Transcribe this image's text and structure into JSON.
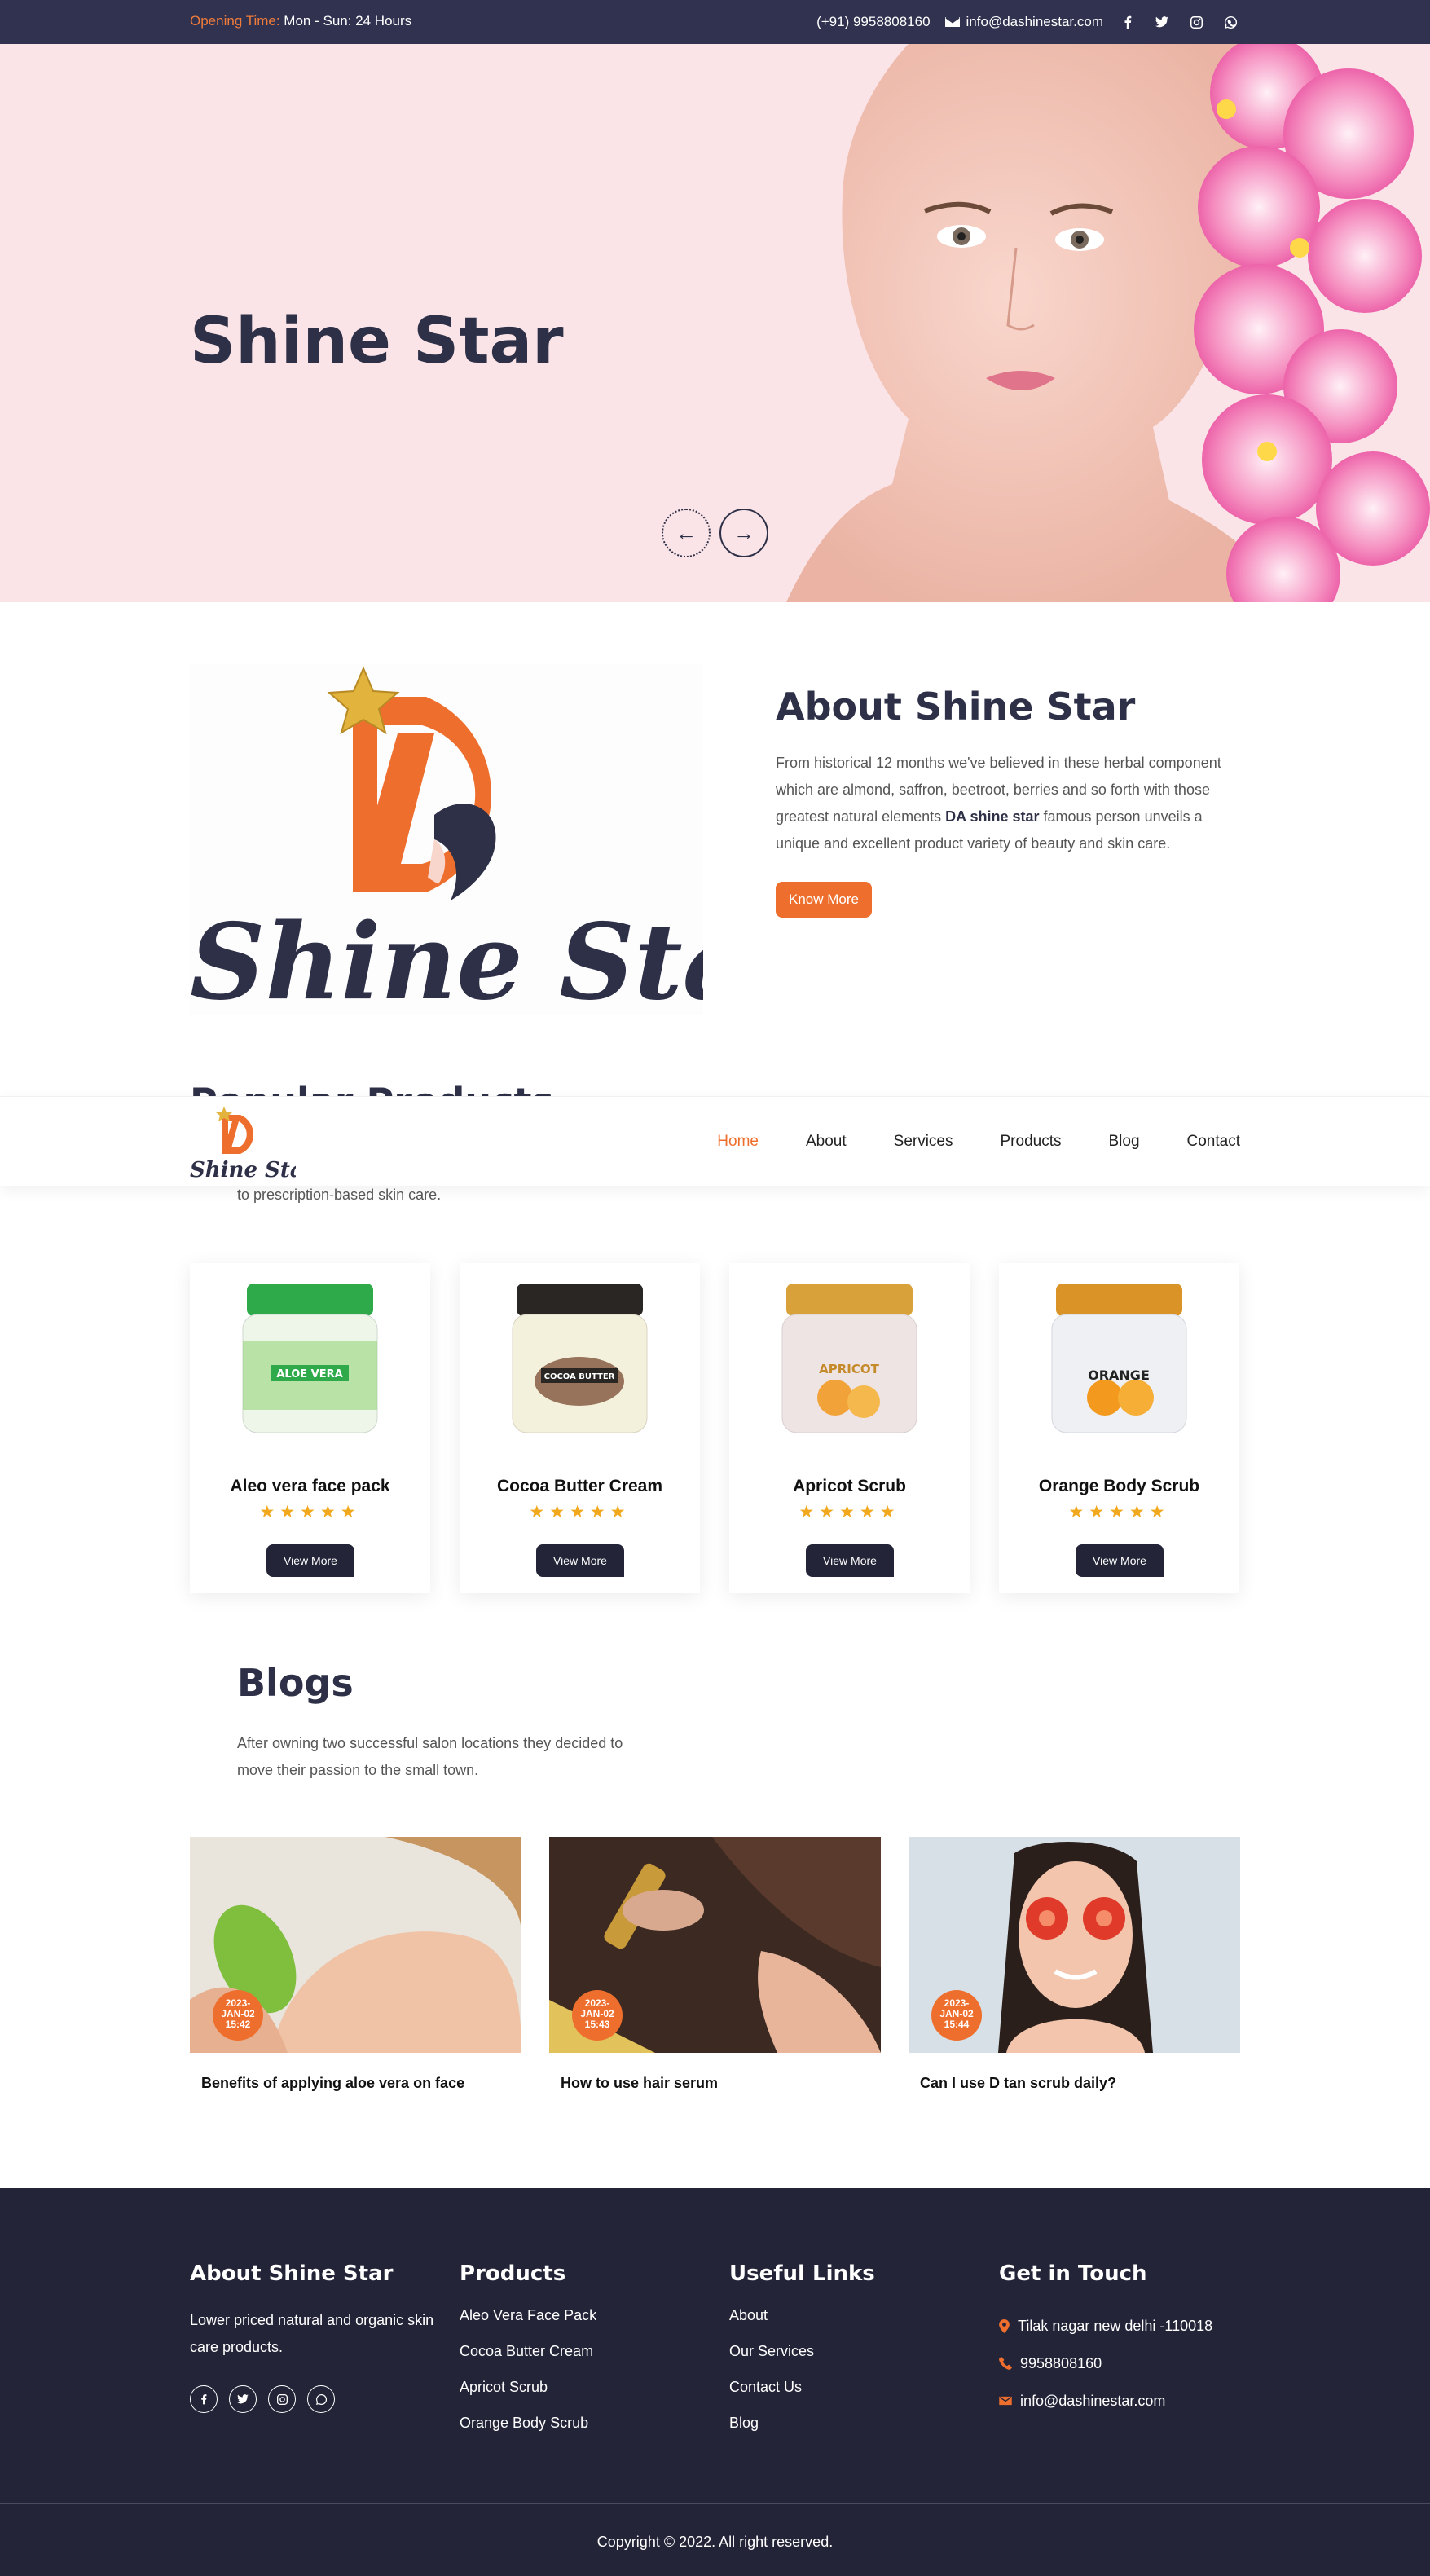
{
  "topbar": {
    "opening_label": "Opening Time:",
    "opening_hours": "Mon - Sun: 24 Hours",
    "phone": "(+91) 9958808160",
    "email": "info@dashinestar.com"
  },
  "hero": {
    "title": "Shine Star"
  },
  "about": {
    "title": "About Shine Star",
    "text_before": "From historical 12 months we've believed in these herbal component which are almond, saffron, beetroot, berries and so forth with those greatest natural elements ",
    "text_bold": "DA shine star",
    "text_after": " famous person unveils a unique and excellent product variety of beauty and skin care.",
    "button": "Know More",
    "logo_text": "Shine Star"
  },
  "nav": {
    "logo_text": "Shine Star",
    "items": [
      "Home",
      "About",
      "Services",
      "Products",
      "Blog",
      "Contact"
    ]
  },
  "products_section": {
    "peek_title": "Popular Products",
    "subtitle": "to prescription-based skin care."
  },
  "products": [
    {
      "name": "Aleo vera face pack",
      "label": "ALOE VERA",
      "button": "View More",
      "stars": "★★★★★",
      "color": "#2eaa4a"
    },
    {
      "name": "Cocoa Butter Cream",
      "label": "COCOA BUTTER",
      "button": "View More",
      "stars": "★★★★★",
      "color": "#2a2623"
    },
    {
      "name": "Apricot Scrub",
      "label": "APRICOT",
      "button": "View More",
      "stars": "★★★★★",
      "color": "#d9a13a"
    },
    {
      "name": "Orange Body Scrub",
      "label": "ORANGE",
      "button": "View More",
      "stars": "★★★★★",
      "color": "#d99326"
    }
  ],
  "blogs": {
    "title": "Blogs",
    "subtitle": "After owning two successful salon locations they decided to move their passion to the small town.",
    "posts": [
      {
        "date_l1": "2023-",
        "date_l2": "JAN-02",
        "date_l3": "15:42",
        "title": "Benefits of applying aloe vera on face"
      },
      {
        "date_l1": "2023-",
        "date_l2": "JAN-02",
        "date_l3": "15:43",
        "title": "How to use hair serum"
      },
      {
        "date_l1": "2023-",
        "date_l2": "JAN-02",
        "date_l3": "15:44",
        "title": "Can I use D tan scrub daily?"
      }
    ]
  },
  "footer": {
    "about_title": "About Shine Star",
    "about_text": "Lower priced natural and organic skin care products.",
    "products_title": "Products",
    "products_links": [
      "Aleo Vera Face Pack",
      "Cocoa Butter Cream",
      "Apricot Scrub",
      "Orange Body Scrub"
    ],
    "links_title": "Useful Links",
    "links": [
      "About",
      "Our Services",
      "Contact Us",
      "Blog"
    ],
    "contact_title": "Get in Touch",
    "address": "Tilak nagar new delhi -110018",
    "phone": "9958808160",
    "email": "info@dashinestar.com",
    "copyright": "Copyright © 2022. All right reserved."
  },
  "colors": {
    "accent": "#ee6f2d",
    "navy": "#2d3047",
    "dark": "#232438",
    "hero_bg": "#fbe4e7",
    "star": "#f2a81d"
  }
}
